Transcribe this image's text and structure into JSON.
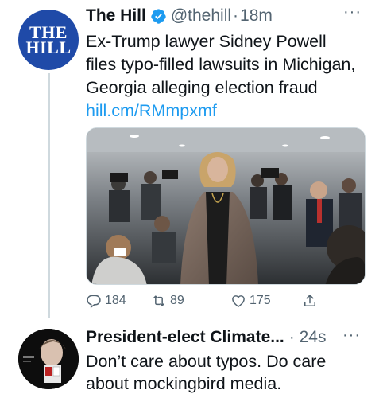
{
  "tweet1": {
    "avatar_text": [
      "THE",
      "HILL"
    ],
    "display_name": "The Hill",
    "handle": "@thehill",
    "separator": "·",
    "time": "18m",
    "more": "···",
    "text": "Ex-Trump lawyer Sidney Powell files typo-filled lawsuits in Michigan, Georgia alleging election fraud ",
    "link": "hill.cm/RMmpxmf",
    "replies": "184",
    "retweets": "89",
    "likes": "175",
    "icons": {
      "verified": "verified-badge-icon",
      "reply": "reply-icon",
      "retweet": "retweet-icon",
      "like": "heart-icon",
      "share": "share-icon"
    },
    "colors": {
      "link": "#1d9bf0",
      "verified": "#1d9bf0",
      "avatar_bg": "#1f4aa8"
    }
  },
  "tweet2": {
    "display_name": "President-elect Climate...",
    "time": "· 24s",
    "more": "···",
    "text": "Don’t care about typos. Do care about mockingbird media."
  }
}
